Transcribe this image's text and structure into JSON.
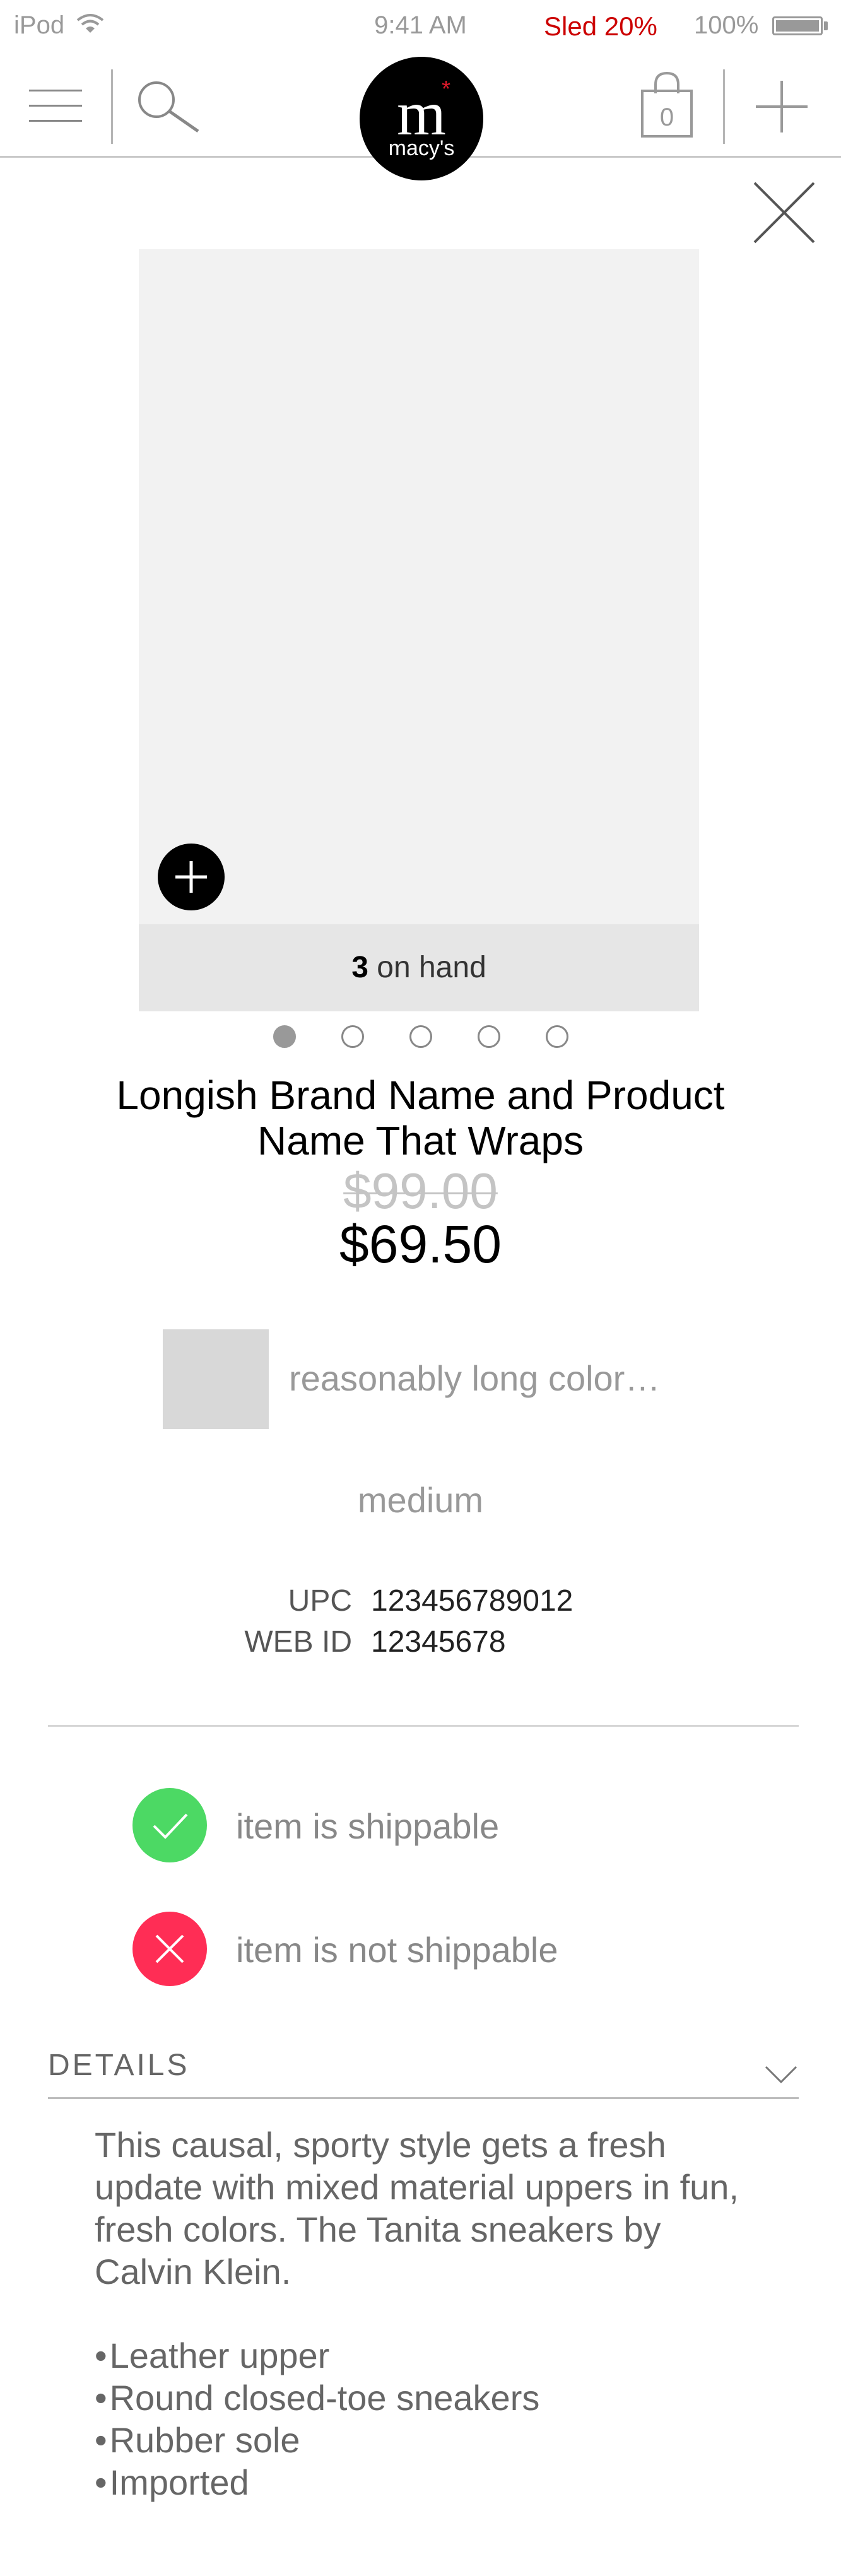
{
  "status_bar": {
    "device": "iPod",
    "time": "9:41 AM",
    "sled": "Sled 20%",
    "battery": "100%"
  },
  "nav": {
    "logo_mark": "m",
    "logo_word": "macy's",
    "logo_star": "*",
    "bag_count": "0",
    "icons": [
      "menu-icon",
      "search-icon",
      "shopping-bag-icon",
      "plus-icon"
    ]
  },
  "product": {
    "on_hand_count": "3",
    "on_hand_label": " on hand",
    "image_count": 5,
    "active_image": 1,
    "title": "Longish Brand Name and Product Name That Wraps",
    "original_price": "$99.00",
    "sale_price": "$69.50",
    "color": "reasonably long color…",
    "size": "medium",
    "upc_label": "UPC",
    "upc": "123456789012",
    "web_id_label": "WEB ID",
    "web_id": "12345678"
  },
  "shipping": {
    "ok_text": "item is shippable",
    "no_text": "item is not shippable",
    "ok_color": "#4cd964",
    "no_color": "#ff2d55"
  },
  "details": {
    "heading": "DETAILS",
    "description": "This causal, sporty style gets a fresh update with mixed material uppers in fun, fresh colors. The Tanita sneakers by Calvin Klein.",
    "bullets": [
      "Leather upper",
      "Round closed-toe sneakers",
      "Rubber sole",
      "Imported"
    ]
  },
  "colors": {
    "sled_red": "#cc0000",
    "logo_star_red": "#e21a2c"
  }
}
